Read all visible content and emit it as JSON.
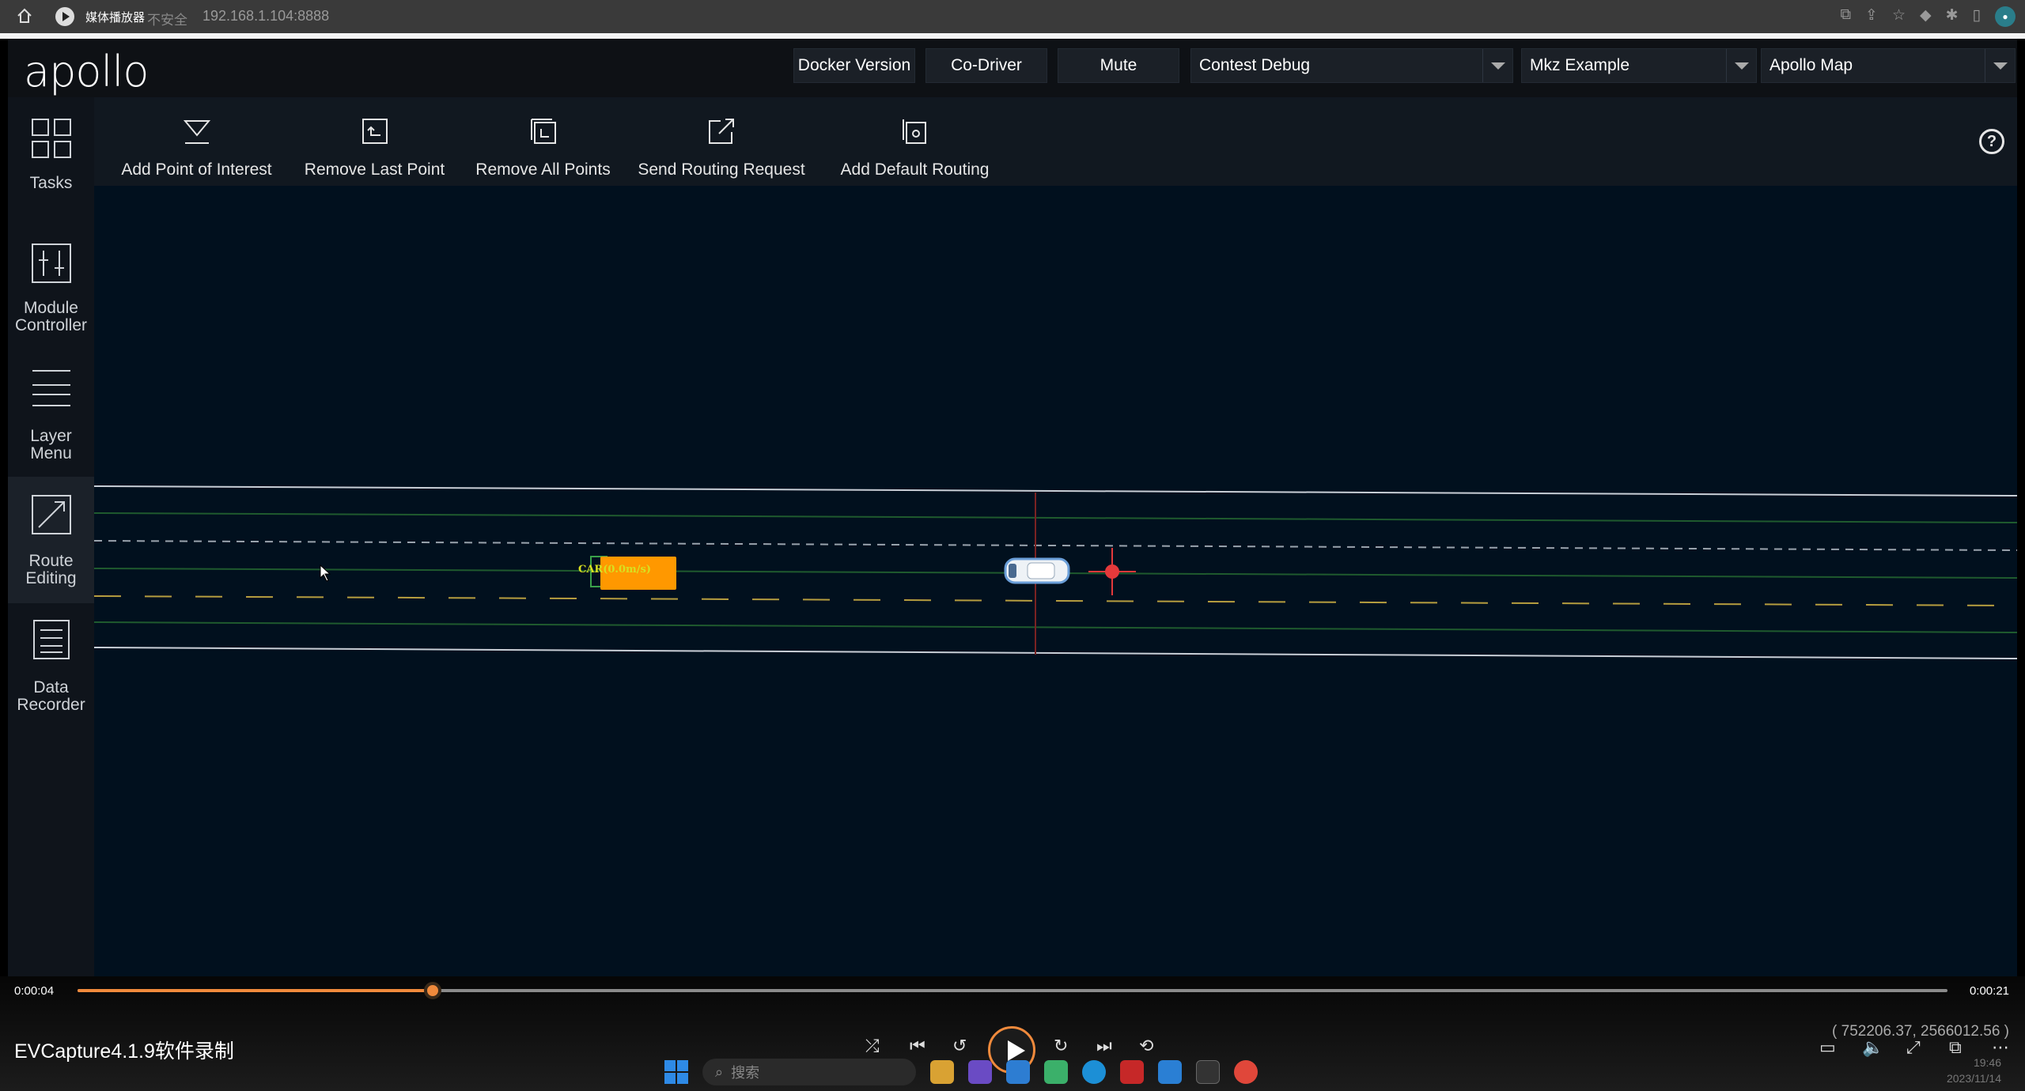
{
  "browser": {
    "app_name": "媒体播放器",
    "insecure_label": "不安全",
    "separator": "|",
    "url": "192.168.1.104:8888"
  },
  "header": {
    "logo": "apollo",
    "buttons": [
      "Docker Version",
      "Co-Driver",
      "Mute"
    ],
    "selects": {
      "mode": "Contest Debug",
      "vehicle": "Mkz Example",
      "map": "Apollo Map"
    }
  },
  "sidebar": {
    "items": [
      {
        "label_1": "Tasks",
        "label_2": ""
      },
      {
        "label_1": "Module",
        "label_2": "Controller"
      },
      {
        "label_1": "Layer",
        "label_2": "Menu"
      },
      {
        "label_1": "Route",
        "label_2": "Editing"
      },
      {
        "label_1": "Data",
        "label_2": "Recorder"
      }
    ],
    "active_index": 3
  },
  "toolbar": {
    "tools": [
      "Add Point of Interest",
      "Remove Last Point",
      "Remove All Points",
      "Send Routing Request",
      "Add Default Routing"
    ],
    "help_label": "?"
  },
  "scene": {
    "obstacle_label": "CAR(0.0m/s)",
    "colors": {
      "background": "#01101e",
      "obstacle": "#ff9800",
      "routing_point": "#e5393b",
      "lane_yellow": "#b69d3f"
    }
  },
  "player": {
    "time_current": "0:00:04",
    "time_total": "0:00:21",
    "progress": 0.19,
    "watermark": "EVCapture4.1.9软件录制",
    "coordinates": "( 752206.37, 2566012.56 )"
  },
  "taskbar": {
    "search_placeholder": "搜索",
    "time": "19:46",
    "date": "2023/11/14"
  }
}
